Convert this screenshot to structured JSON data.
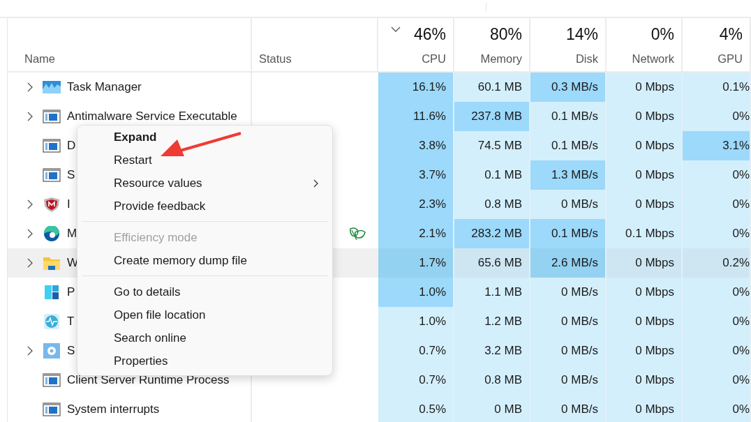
{
  "columns": [
    {
      "label": "Name"
    },
    {
      "label": "Status"
    },
    {
      "label": "CPU",
      "total": "46%",
      "sorted": true
    },
    {
      "label": "Memory",
      "total": "80%",
      "sorted": false
    },
    {
      "label": "Disk",
      "total": "14%",
      "sorted": false
    },
    {
      "label": "Network",
      "total": "0%",
      "sorted": false
    },
    {
      "label": "GPU",
      "total": "4%",
      "sorted": false
    }
  ],
  "rows": [
    {
      "name": "Task Manager",
      "kind": "chart",
      "expandable": true,
      "selected": false,
      "cells": [
        {
          "text": "16.1%",
          "highlighted": true
        },
        {
          "text": "60.1 MB",
          "highlighted": false
        },
        {
          "text": "0.3 MB/s",
          "highlighted": true
        },
        {
          "text": "0 Mbps",
          "highlighted": false
        },
        {
          "text": "0.1%",
          "highlighted": false
        }
      ]
    },
    {
      "name": "Antimalware Service Executable",
      "kind": "window",
      "expandable": true,
      "selected": false,
      "cells": [
        {
          "text": "11.6%",
          "highlighted": true
        },
        {
          "text": "237.8 MB",
          "highlighted": true
        },
        {
          "text": "0.1 MB/s",
          "highlighted": false
        },
        {
          "text": "0 Mbps",
          "highlighted": false
        },
        {
          "text": "0%",
          "highlighted": false
        }
      ]
    },
    {
      "name": "D",
      "kind": "window",
      "expandable": false,
      "selected": false,
      "cells": [
        {
          "text": "3.8%",
          "highlighted": true
        },
        {
          "text": "74.5 MB",
          "highlighted": false
        },
        {
          "text": "0.1 MB/s",
          "highlighted": false
        },
        {
          "text": "0 Mbps",
          "highlighted": false
        },
        {
          "text": "3.1%",
          "highlighted": true
        }
      ]
    },
    {
      "name": "S",
      "kind": "window",
      "expandable": false,
      "selected": false,
      "cells": [
        {
          "text": "3.7%",
          "highlighted": true
        },
        {
          "text": "0.1 MB",
          "highlighted": false
        },
        {
          "text": "1.3 MB/s",
          "highlighted": true
        },
        {
          "text": "0 Mbps",
          "highlighted": false
        },
        {
          "text": "0%",
          "highlighted": false
        }
      ]
    },
    {
      "name": "I",
      "kind": "shield",
      "expandable": true,
      "selected": false,
      "cells": [
        {
          "text": "2.3%",
          "highlighted": true
        },
        {
          "text": "0.8 MB",
          "highlighted": false
        },
        {
          "text": "0 MB/s",
          "highlighted": false
        },
        {
          "text": "0 Mbps",
          "highlighted": false
        },
        {
          "text": "0%",
          "highlighted": false
        }
      ]
    },
    {
      "name": "M",
      "kind": "browser",
      "expandable": true,
      "selected": false,
      "efficiency": true,
      "cells": [
        {
          "text": "2.1%",
          "highlighted": true
        },
        {
          "text": "283.2 MB",
          "highlighted": true
        },
        {
          "text": "0.1 MB/s",
          "highlighted": true
        },
        {
          "text": "0.1 Mbps",
          "highlighted": false
        },
        {
          "text": "0%",
          "highlighted": false
        }
      ]
    },
    {
      "name": "W",
      "kind": "folder",
      "expandable": true,
      "selected": true,
      "cells": [
        {
          "text": "1.7%",
          "highlighted": true
        },
        {
          "text": "65.6 MB",
          "highlighted": false
        },
        {
          "text": "2.6 MB/s",
          "highlighted": true
        },
        {
          "text": "0 Mbps",
          "highlighted": false
        },
        {
          "text": "0.2%",
          "highlighted": false
        }
      ]
    },
    {
      "name": "P",
      "kind": "tiles",
      "expandable": false,
      "selected": false,
      "cells": [
        {
          "text": "1.0%",
          "highlighted": true
        },
        {
          "text": "1.1 MB",
          "highlighted": false
        },
        {
          "text": "0 MB/s",
          "highlighted": false
        },
        {
          "text": "0 Mbps",
          "highlighted": false
        },
        {
          "text": "0%",
          "highlighted": false
        }
      ]
    },
    {
      "name": "T",
      "kind": "pulse",
      "expandable": false,
      "selected": false,
      "cells": [
        {
          "text": "1.0%",
          "highlighted": false
        },
        {
          "text": "1.2 MB",
          "highlighted": false
        },
        {
          "text": "0 MB/s",
          "highlighted": false
        },
        {
          "text": "0 Mbps",
          "highlighted": false
        },
        {
          "text": "0%",
          "highlighted": false
        }
      ]
    },
    {
      "name": "S",
      "kind": "gear",
      "expandable": true,
      "selected": false,
      "cells": [
        {
          "text": "0.7%",
          "highlighted": false
        },
        {
          "text": "3.2 MB",
          "highlighted": false
        },
        {
          "text": "0 MB/s",
          "highlighted": false
        },
        {
          "text": "0 Mbps",
          "highlighted": false
        },
        {
          "text": "0%",
          "highlighted": false
        }
      ]
    },
    {
      "name": "Client Server Runtime Process",
      "kind": "window",
      "expandable": false,
      "selected": false,
      "cells": [
        {
          "text": "0.7%",
          "highlighted": false
        },
        {
          "text": "0.8 MB",
          "highlighted": false
        },
        {
          "text": "0 MB/s",
          "highlighted": false
        },
        {
          "text": "0 Mbps",
          "highlighted": false
        },
        {
          "text": "0%",
          "highlighted": false
        }
      ]
    },
    {
      "name": "System interrupts",
      "kind": "window",
      "expandable": false,
      "selected": false,
      "cells": [
        {
          "text": "0.5%",
          "highlighted": false
        },
        {
          "text": "0 MB",
          "highlighted": false
        },
        {
          "text": "0 MB/s",
          "highlighted": false
        },
        {
          "text": "0 Mbps",
          "highlighted": false
        },
        {
          "text": "0%",
          "highlighted": false
        }
      ]
    }
  ],
  "context_menu": {
    "items": [
      {
        "kind": "item",
        "label": "Expand",
        "default": true,
        "disabled": false,
        "submenu": false
      },
      {
        "kind": "item",
        "label": "Restart",
        "default": false,
        "disabled": false,
        "submenu": false
      },
      {
        "kind": "item",
        "label": "Resource values",
        "default": false,
        "disabled": false,
        "submenu": true
      },
      {
        "kind": "item",
        "label": "Provide feedback",
        "default": false,
        "disabled": false,
        "submenu": false
      },
      {
        "kind": "separator"
      },
      {
        "kind": "item",
        "label": "Efficiency mode",
        "default": false,
        "disabled": true,
        "submenu": false
      },
      {
        "kind": "item",
        "label": "Create memory dump file",
        "default": false,
        "disabled": false,
        "submenu": false
      },
      {
        "kind": "separator"
      },
      {
        "kind": "item",
        "label": "Go to details",
        "default": false,
        "disabled": false,
        "submenu": false
      },
      {
        "kind": "item",
        "label": "Open file location",
        "default": false,
        "disabled": false,
        "submenu": false
      },
      {
        "kind": "item",
        "label": "Search online",
        "default": false,
        "disabled": false,
        "submenu": false
      },
      {
        "kind": "item",
        "label": "Properties",
        "default": false,
        "disabled": false,
        "submenu": false
      }
    ]
  }
}
